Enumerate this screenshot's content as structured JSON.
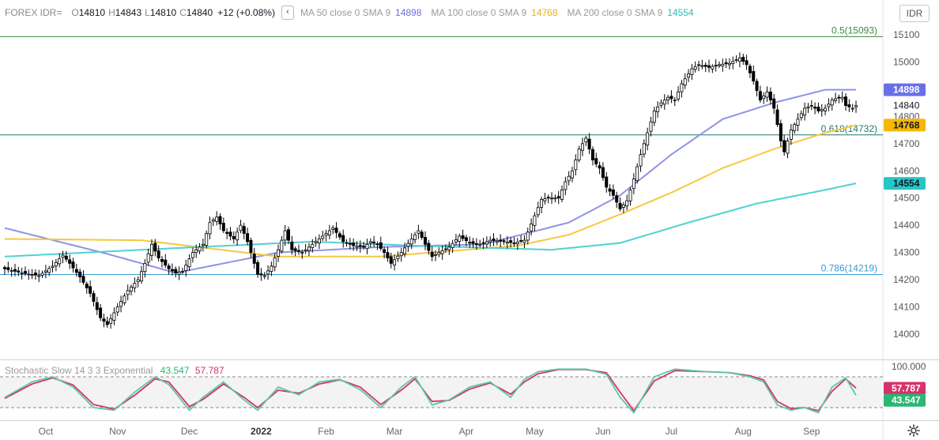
{
  "header": {
    "symbol": "FOREX IDR=",
    "open_label": "O",
    "open": "14810",
    "high_label": "H",
    "high": "14843",
    "low_label": "L",
    "low": "14810",
    "close_label": "C",
    "close": "14840",
    "change": "+12 (+0.08%)",
    "toggle_icon": "chevron-left-icon",
    "ma50_label": "MA 50 close 0 SMA 9",
    "ma50_value": "14898",
    "ma100_label": "MA 100 close 0 SMA 9",
    "ma100_value": "14768",
    "ma200_label": "MA 200 close 0 SMA 9",
    "ma200_value": "14554"
  },
  "currency_button": "IDR",
  "stochastic": {
    "label": "Stochastic Slow 14 3 3 Exponential",
    "k_value": "43.547",
    "d_value": "57.787"
  },
  "settings_icon": "gear-icon",
  "colors": {
    "up": "#ffffff",
    "down": "#000000",
    "candle_border": "#000000",
    "ma50": "#8f93e6",
    "ma100": "#f5c842",
    "ma200": "#4fd1d1",
    "fib_05": "#3a8a3a",
    "fib_0618": "#1f7a6a",
    "fib_0786": "#3a9ad0",
    "stoch_k": "#5cc8a8",
    "stoch_d": "#d4336a"
  },
  "chart_data": [
    {
      "type": "candlestick",
      "title": "FOREX IDR=",
      "x_ticks": [
        "Oct",
        "Nov",
        "Dec",
        "2022",
        "Feb",
        "Mar",
        "Apr",
        "May",
        "Jun",
        "Jul",
        "Aug",
        "Sep"
      ],
      "y_ticks": [
        14000,
        14100,
        14200,
        14300,
        14400,
        14500,
        14600,
        14700,
        14800,
        15000,
        15100
      ],
      "ylim": [
        13910,
        15135
      ],
      "grid": false,
      "last_price": 14840,
      "fib_levels": [
        {
          "label": "0.5(15093)",
          "value": 15093
        },
        {
          "label": "0.618(14732)",
          "value": 14732
        },
        {
          "label": "0.786(14219)",
          "value": 14219
        }
      ],
      "ma_last": {
        "ma50": 14898,
        "ma100": 14768,
        "ma200": 14554
      },
      "series": [
        {
          "name": "Price",
          "anchors": [
            [
              0,
              14240
            ],
            [
              5,
              14225
            ],
            [
              10,
              14215
            ],
            [
              14,
              14250
            ],
            [
              17,
              14290
            ],
            [
              19,
              14260
            ],
            [
              22,
              14210
            ],
            [
              25,
              14150
            ],
            [
              28,
              14060
            ],
            [
              30,
              14035
            ],
            [
              33,
              14100
            ],
            [
              36,
              14160
            ],
            [
              39,
              14200
            ],
            [
              41,
              14260
            ],
            [
              43,
              14330
            ],
            [
              45,
              14280
            ],
            [
              48,
              14240
            ],
            [
              50,
              14225
            ],
            [
              52,
              14230
            ],
            [
              55,
              14300
            ],
            [
              58,
              14330
            ],
            [
              60,
              14410
            ],
            [
              62,
              14430
            ],
            [
              64,
              14380
            ],
            [
              67,
              14350
            ],
            [
              69,
              14400
            ],
            [
              71,
              14340
            ],
            [
              74,
              14220
            ],
            [
              76,
              14215
            ],
            [
              78,
              14250
            ],
            [
              80,
              14310
            ],
            [
              82,
              14380
            ],
            [
              84,
              14310
            ],
            [
              87,
              14300
            ],
            [
              90,
              14330
            ],
            [
              93,
              14360
            ],
            [
              96,
              14390
            ],
            [
              99,
              14340
            ],
            [
              102,
              14325
            ],
            [
              105,
              14320
            ],
            [
              107,
              14340
            ],
            [
              109,
              14330
            ],
            [
              111,
              14300
            ],
            [
              113,
              14260
            ],
            [
              116,
              14300
            ],
            [
              119,
              14350
            ],
            [
              121,
              14380
            ],
            [
              123,
              14330
            ],
            [
              125,
              14285
            ],
            [
              127,
              14300
            ],
            [
              130,
              14320
            ],
            [
              133,
              14360
            ],
            [
              136,
              14335
            ],
            [
              139,
              14330
            ],
            [
              142,
              14345
            ],
            [
              146,
              14340
            ],
            [
              149,
              14335
            ],
            [
              152,
              14345
            ],
            [
              155,
              14435
            ],
            [
              157,
              14495
            ],
            [
              159,
              14500
            ],
            [
              162,
              14500
            ],
            [
              164,
              14560
            ],
            [
              166,
              14600
            ],
            [
              168,
              14680
            ],
            [
              170,
              14720
            ],
            [
              172,
              14640
            ],
            [
              174,
              14610
            ],
            [
              176,
              14540
            ],
            [
              178,
              14510
            ],
            [
              180,
              14460
            ],
            [
              182,
              14490
            ],
            [
              184,
              14570
            ],
            [
              186,
              14660
            ],
            [
              188,
              14740
            ],
            [
              190,
              14820
            ],
            [
              192,
              14850
            ],
            [
              194,
              14870
            ],
            [
              196,
              14860
            ],
            [
              198,
              14920
            ],
            [
              201,
              14975
            ],
            [
              203,
              14990
            ],
            [
              206,
              14980
            ],
            [
              209,
              14990
            ],
            [
              212,
              14995
            ],
            [
              215,
              15015
            ],
            [
              217,
              14990
            ],
            [
              219,
              14930
            ],
            [
              221,
              14860
            ],
            [
              223,
              14890
            ],
            [
              225,
              14830
            ],
            [
              227,
              14710
            ],
            [
              228,
              14670
            ],
            [
              230,
              14750
            ],
            [
              232,
              14790
            ],
            [
              234,
              14830
            ],
            [
              236,
              14840
            ],
            [
              238,
              14820
            ],
            [
              240,
              14830
            ],
            [
              242,
              14860
            ],
            [
              244,
              14870
            ],
            [
              245,
              14870
            ],
            [
              246,
              14840
            ],
            [
              248,
              14830
            ],
            [
              249,
              14840
            ]
          ]
        },
        {
          "name": "MA 50",
          "anchors": [
            [
              0,
              14390
            ],
            [
              30,
              14295
            ],
            [
              50,
              14225
            ],
            [
              80,
              14300
            ],
            [
              110,
              14320
            ],
            [
              140,
              14330
            ],
            [
              165,
              14410
            ],
            [
              180,
              14510
            ],
            [
              195,
              14660
            ],
            [
              210,
              14790
            ],
            [
              225,
              14850
            ],
            [
              240,
              14898
            ],
            [
              249,
              14898
            ]
          ]
        },
        {
          "name": "MA 100",
          "anchors": [
            [
              0,
              14350
            ],
            [
              40,
              14345
            ],
            [
              80,
              14285
            ],
            [
              110,
              14285
            ],
            [
              150,
              14325
            ],
            [
              165,
              14365
            ],
            [
              180,
              14440
            ],
            [
              195,
              14520
            ],
            [
              210,
              14610
            ],
            [
              225,
              14680
            ],
            [
              240,
              14740
            ],
            [
              249,
              14768
            ]
          ]
        },
        {
          "name": "MA 200",
          "anchors": [
            [
              0,
              14285
            ],
            [
              40,
              14310
            ],
            [
              90,
              14340
            ],
            [
              120,
              14325
            ],
            [
              160,
              14310
            ],
            [
              180,
              14335
            ],
            [
              200,
              14410
            ],
            [
              220,
              14480
            ],
            [
              240,
              14530
            ],
            [
              249,
              14554
            ]
          ]
        }
      ]
    },
    {
      "type": "line",
      "title": "Stochastic Slow 14 3 3 Exponential",
      "ylim": [
        0,
        100
      ],
      "y_ticks": [
        100.0
      ],
      "levels": [
        80,
        20
      ],
      "series": [
        {
          "name": "%K",
          "last": 43.547,
          "anchors": [
            [
              0,
              40
            ],
            [
              8,
              70
            ],
            [
              14,
              80
            ],
            [
              20,
              60
            ],
            [
              26,
              20
            ],
            [
              32,
              15
            ],
            [
              38,
              50
            ],
            [
              44,
              80
            ],
            [
              48,
              65
            ],
            [
              54,
              15
            ],
            [
              58,
              40
            ],
            [
              64,
              70
            ],
            [
              70,
              35
            ],
            [
              74,
              15
            ],
            [
              80,
              60
            ],
            [
              86,
              45
            ],
            [
              92,
              70
            ],
            [
              98,
              75
            ],
            [
              104,
              55
            ],
            [
              110,
              20
            ],
            [
              116,
              60
            ],
            [
              120,
              80
            ],
            [
              125,
              25
            ],
            [
              130,
              35
            ],
            [
              136,
              60
            ],
            [
              142,
              70
            ],
            [
              148,
              40
            ],
            [
              152,
              75
            ],
            [
              156,
              90
            ],
            [
              162,
              95
            ],
            [
              170,
              95
            ],
            [
              176,
              85
            ],
            [
              180,
              40
            ],
            [
              184,
              10
            ],
            [
              190,
              80
            ],
            [
              196,
              95
            ],
            [
              205,
              90
            ],
            [
              212,
              88
            ],
            [
              218,
              80
            ],
            [
              222,
              70
            ],
            [
              226,
              25
            ],
            [
              230,
              15
            ],
            [
              234,
              20
            ],
            [
              238,
              10
            ],
            [
              242,
              60
            ],
            [
              246,
              78
            ],
            [
              249,
              44
            ]
          ]
        },
        {
          "name": "%D",
          "last": 57.787,
          "anchors": [
            [
              0,
              38
            ],
            [
              8,
              66
            ],
            [
              14,
              78
            ],
            [
              20,
              64
            ],
            [
              26,
              26
            ],
            [
              32,
              17
            ],
            [
              38,
              44
            ],
            [
              44,
              76
            ],
            [
              48,
              70
            ],
            [
              54,
              22
            ],
            [
              58,
              36
            ],
            [
              64,
              66
            ],
            [
              70,
              40
            ],
            [
              74,
              20
            ],
            [
              80,
              54
            ],
            [
              86,
              48
            ],
            [
              92,
              66
            ],
            [
              98,
              74
            ],
            [
              104,
              60
            ],
            [
              110,
              26
            ],
            [
              116,
              54
            ],
            [
              120,
              76
            ],
            [
              125,
              32
            ],
            [
              130,
              34
            ],
            [
              136,
              56
            ],
            [
              142,
              68
            ],
            [
              148,
              46
            ],
            [
              152,
              70
            ],
            [
              156,
              86
            ],
            [
              162,
              94
            ],
            [
              170,
              94
            ],
            [
              176,
              88
            ],
            [
              180,
              50
            ],
            [
              184,
              14
            ],
            [
              190,
              72
            ],
            [
              196,
              92
            ],
            [
              205,
              90
            ],
            [
              212,
              88
            ],
            [
              218,
              82
            ],
            [
              222,
              74
            ],
            [
              226,
              32
            ],
            [
              230,
              18
            ],
            [
              234,
              20
            ],
            [
              238,
              14
            ],
            [
              242,
              52
            ],
            [
              246,
              76
            ],
            [
              249,
              58
            ]
          ]
        }
      ]
    }
  ]
}
